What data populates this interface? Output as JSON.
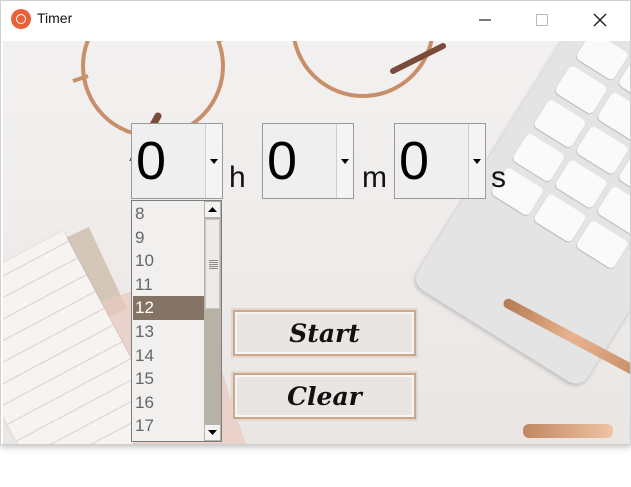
{
  "window": {
    "title": "Timer"
  },
  "icons": {
    "app": "timer-app-icon",
    "minimize": "minimize-icon",
    "maximize": "maximize-icon",
    "close": "close-icon",
    "dropdown": "chevron-down-icon",
    "scroll_up": "scroll-up-icon",
    "scroll_down": "scroll-down-icon"
  },
  "timer": {
    "hours": {
      "value": "0",
      "unit": "h"
    },
    "minutes": {
      "value": "0",
      "unit": "m"
    },
    "seconds": {
      "value": "0",
      "unit": "s"
    }
  },
  "dropdown": {
    "items": [
      "8",
      "9",
      "10",
      "11",
      "12",
      "13",
      "14",
      "15",
      "16",
      "17"
    ],
    "selected": "12"
  },
  "buttons": {
    "start": "Start",
    "clear": "Clear"
  },
  "colors": {
    "selected_item_bg": "#857465",
    "button_border": "#c9a98d",
    "app_icon": "#e8603c"
  }
}
